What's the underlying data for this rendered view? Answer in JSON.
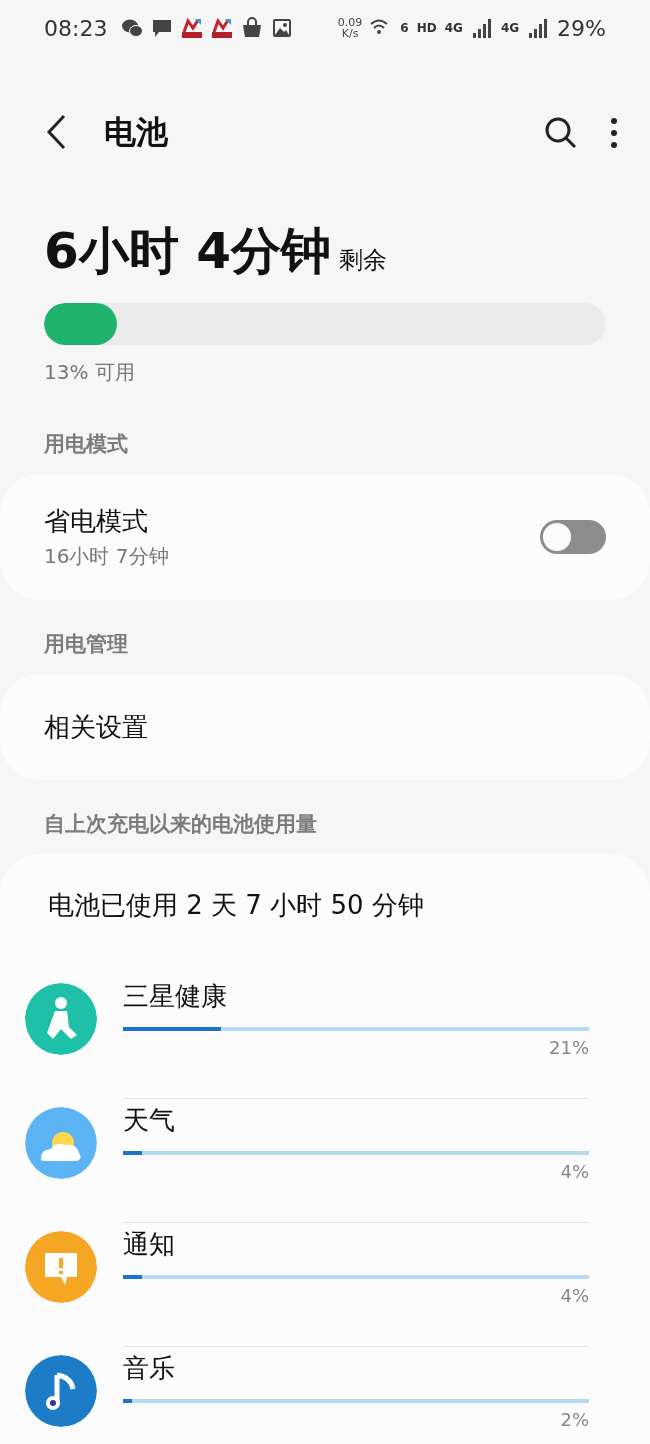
{
  "status_bar": {
    "time": "08:23",
    "net_speed": "0.09",
    "net_unit": "K/s",
    "wifi_badge": "6",
    "hd": "HD",
    "sim1": "4G",
    "sim2": "4G",
    "battery": "29%"
  },
  "header": {
    "title": "电池"
  },
  "summary": {
    "time_left": "6小时 4分钟",
    "suffix": "剩余",
    "level": 0.13,
    "available": "13% 可用"
  },
  "sections": [
    {
      "heading": "用电模式",
      "kind": "toggle",
      "title": "省电模式",
      "subtitle": "16小时 7分钟",
      "on": false
    },
    {
      "heading": "用电管理",
      "kind": "link",
      "title": "相关设置"
    }
  ],
  "usage": {
    "heading": "自上次充电以来的电池使用量",
    "total": "电池已使用 2 天 7 小时 50 分钟",
    "apps": [
      {
        "name": "三星健康",
        "level": 0.21,
        "percent": "21%",
        "color": "#1fc0a8"
      },
      {
        "name": "天气",
        "level": 0.04,
        "percent": "4%",
        "color": "#5cb4f5"
      },
      {
        "name": "通知",
        "level": 0.04,
        "percent": "4%",
        "color": "#f5a623"
      },
      {
        "name": "音乐",
        "level": 0.02,
        "percent": "2%",
        "color": "#1c7cc7"
      }
    ]
  }
}
